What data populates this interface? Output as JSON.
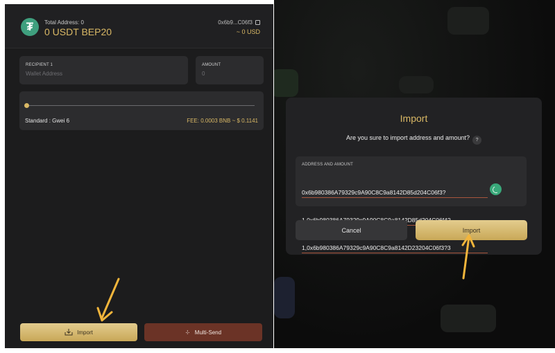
{
  "wallet": {
    "total_address": "Total Address: 0",
    "balance": "0 USDT",
    "network": "BEP20",
    "address": "0x6b9...C06f3",
    "usd_value": "~ 0 USD",
    "logo_glyph": "₮"
  },
  "recipient": {
    "label": "RECIPIENT 1",
    "placeholder": "Wallet Address"
  },
  "amount": {
    "label": "AMOUNT",
    "placeholder": "0"
  },
  "fee": {
    "speed": "Standard : Gwei 6",
    "text": "FEE: 0.0003 BNB ~ $ 0.1141",
    "slider_position": 0
  },
  "buttons": {
    "import": "Import",
    "multi_send": "Multi-Send"
  },
  "modal": {
    "title": "Import",
    "question": "Are you sure to import address and amount?",
    "help": "?",
    "field_label": "ADDRESS AND AMOUNT",
    "lines": [
      "0x6b980386A79329c9A90C8C9a8142D85d204C06f3?",
      "1,0x6b980386A79329c9A90C8C9a8142D85d204C06f4?",
      "1,0x6b980386A79329c9A90C8C9a8142D23204C06f3?3"
    ],
    "cancel": "Cancel",
    "confirm": "Import"
  },
  "colors": {
    "accent": "#d9b865",
    "brand_green": "#3f9f7e",
    "multi_send": "#6b3326",
    "arrow": "#f2b53b"
  }
}
